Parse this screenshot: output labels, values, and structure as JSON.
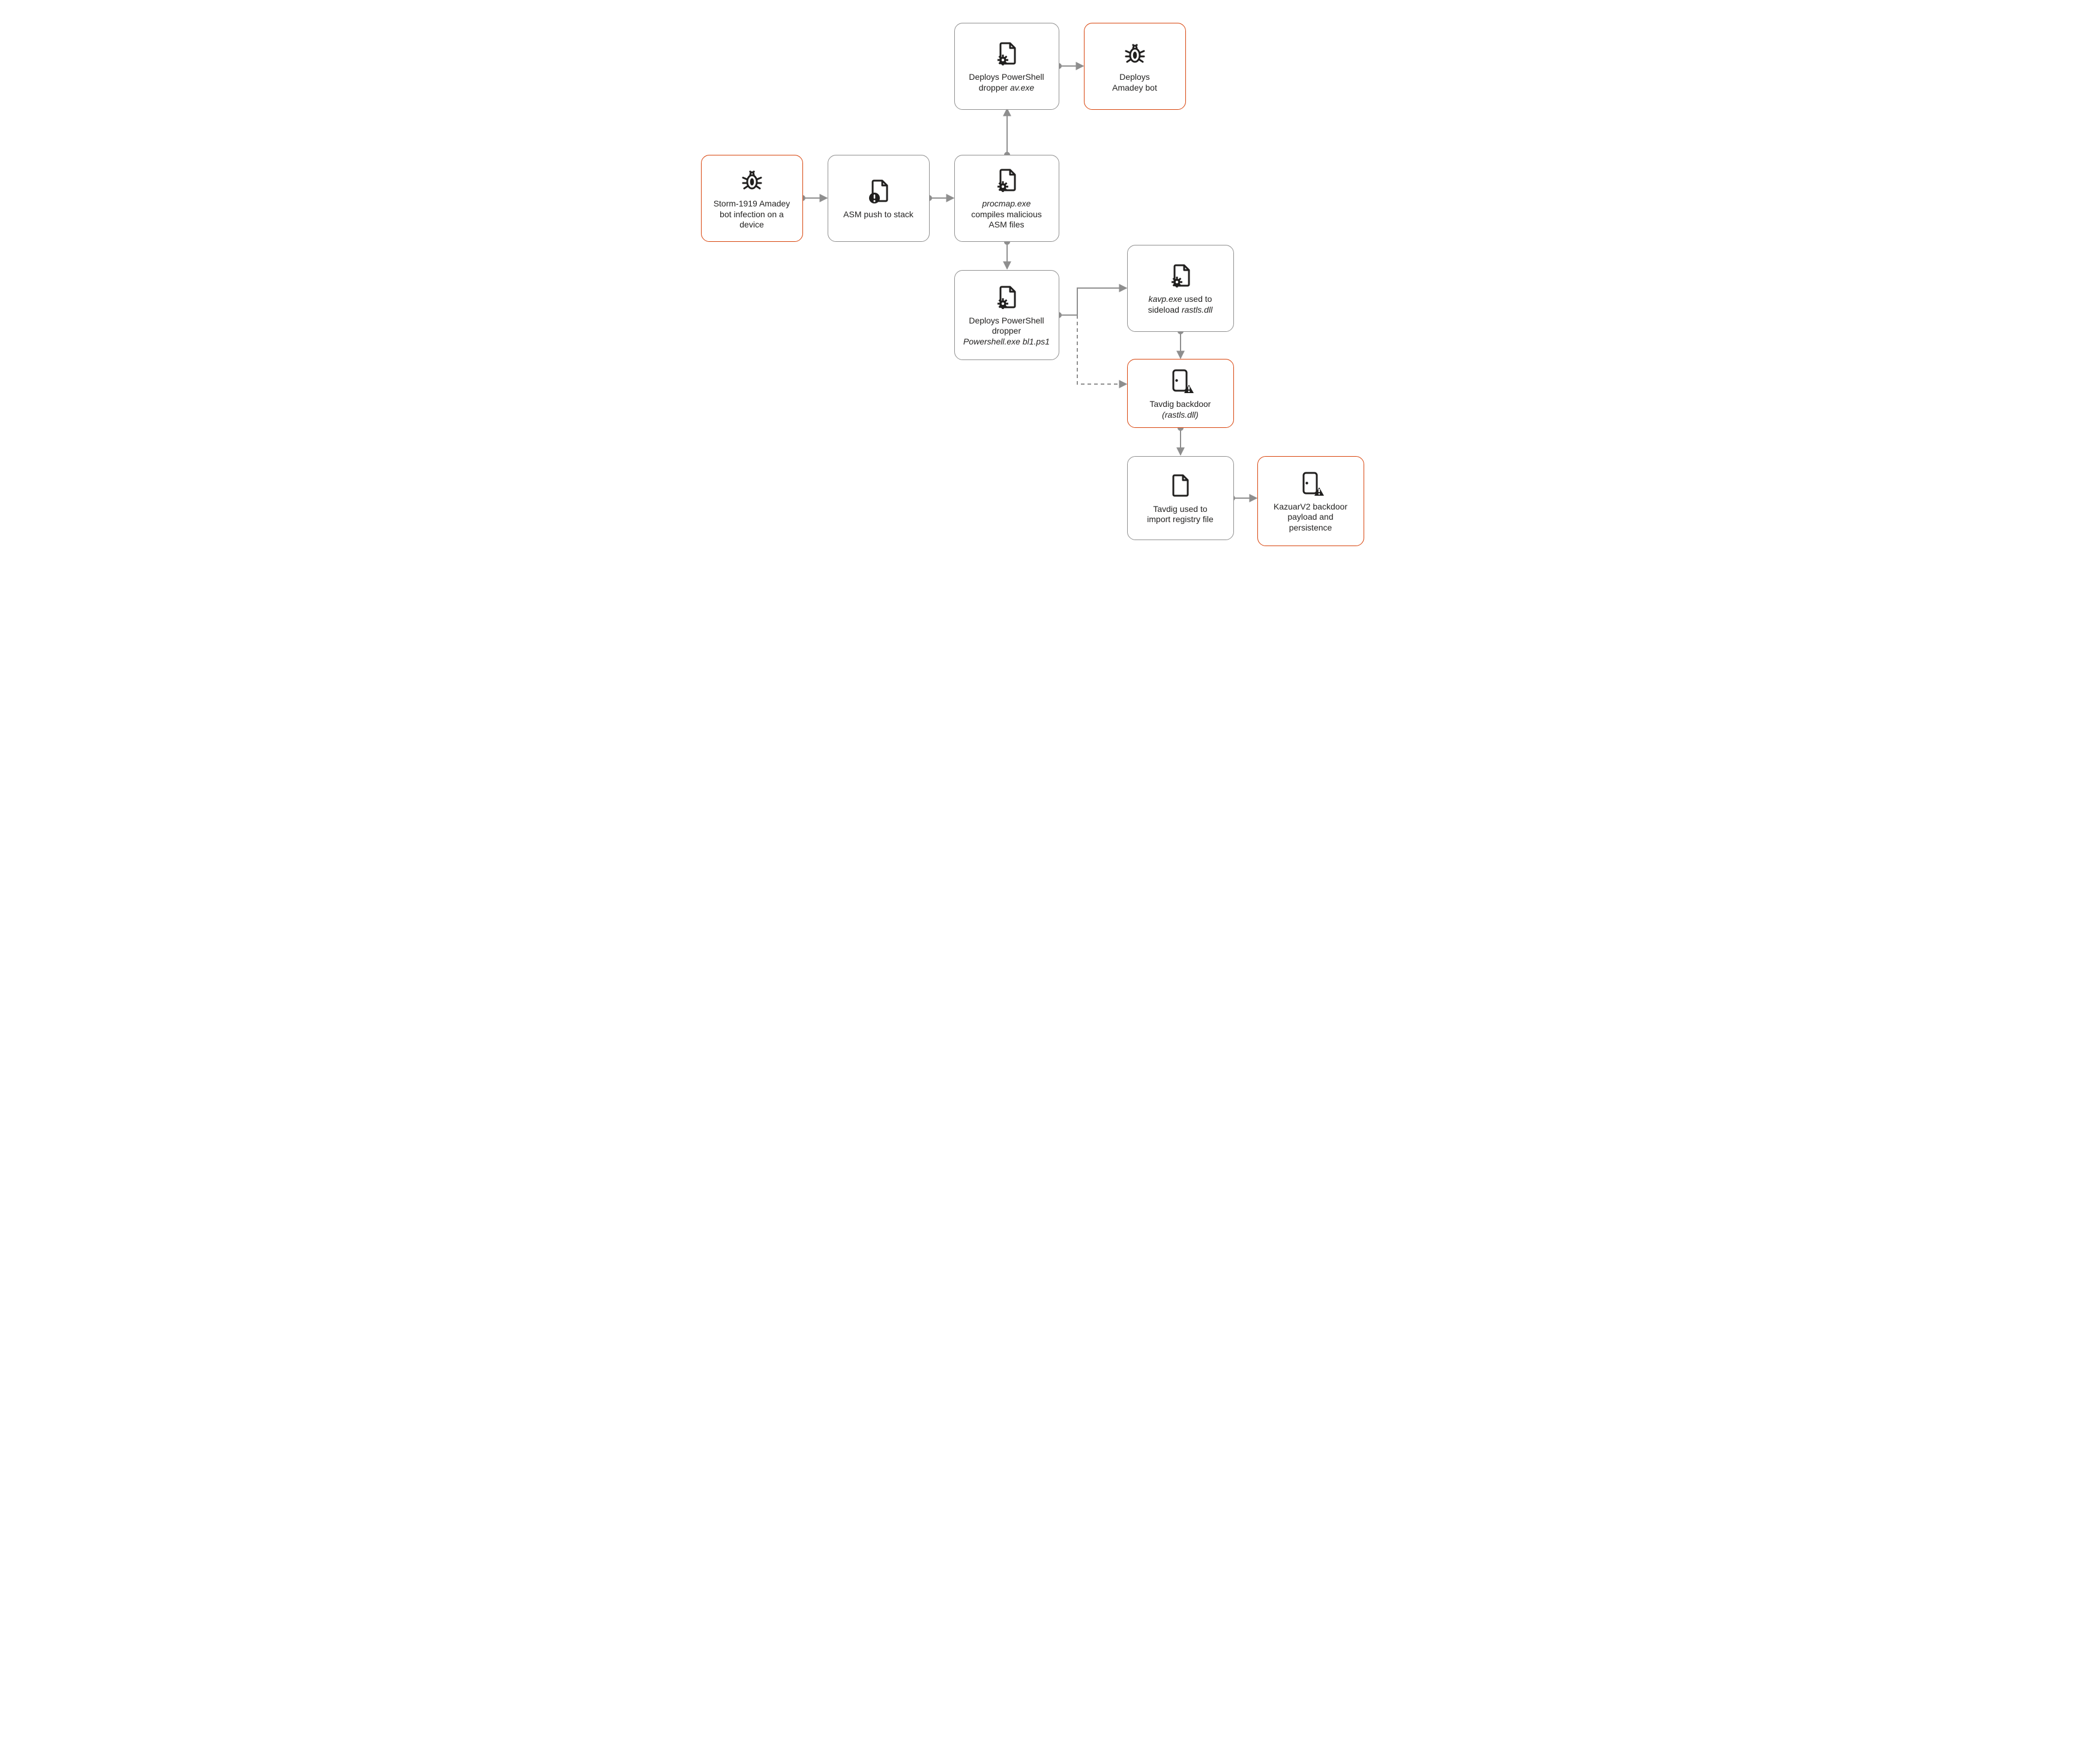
{
  "diagram": {
    "nodes": {
      "n1": {
        "line1": "Storm-1919 Amadey",
        "line2": "bot infection on a",
        "line3": "device"
      },
      "n2": {
        "line1": "ASM push to stack"
      },
      "n3": {
        "pre": "procmap.exe",
        "line1": "",
        "line2": "compiles malicious",
        "line3": "ASM files"
      },
      "n4": {
        "line1": "Deploys PowerShell",
        "line2": "dropper ",
        "post": "av.exe"
      },
      "n5": {
        "line1": "Deploys",
        "line2": "Amadey bot"
      },
      "n6": {
        "line1": "Deploys PowerShell",
        "line2": "dropper",
        "post": "Powershell.exe bl1.ps1"
      },
      "n7": {
        "pre": "kavp.exe",
        "mid": " used to",
        "line2": "sideload ",
        "post": "rastls.dll"
      },
      "n8": {
        "line1": "Tavdig backdoor",
        "post": "(rastls.dll)"
      },
      "n9": {
        "line1": "Tavdig used to",
        "line2": "import registry file"
      },
      "n10": {
        "line1": "KazuarV2 backdoor",
        "line2": "payload and",
        "line3": "persistence"
      }
    },
    "icons": {
      "bug": "bug-icon",
      "filealert": "file-alert-icon",
      "filegear": "file-gear-icon",
      "file": "file-icon",
      "dooralert": "door-alert-icon"
    }
  }
}
